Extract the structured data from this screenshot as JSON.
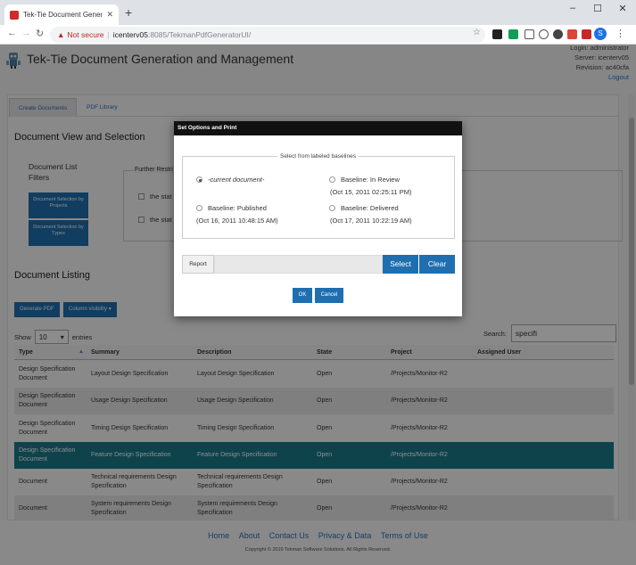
{
  "browser": {
    "tab_title": "Tek-Tie Document Generation a",
    "url_not_secure": "Not secure",
    "url_host": "icenterv05",
    "url_path": ":8085/TekmanPdfGeneratorUI/",
    "profile_initial": "S"
  },
  "header": {
    "title": "Tek-Tie Document Generation and Management",
    "login": "Login: administrator",
    "server": "Server: icenterv05",
    "revision": "Revision: ac40cfa",
    "logout": "Logout"
  },
  "tabs": [
    "Create Documents",
    "PDF Library"
  ],
  "view": {
    "title": "Document View and Selection",
    "filters_title": "Document List Filters",
    "btn_projects": "Document Selection by Projects",
    "btn_types": "Document Selection by Types",
    "further_label": "Further Restri",
    "check1": "the stat",
    "check2": "the stat"
  },
  "listing": {
    "title": "Document Listing",
    "generate_pdf": "Generate PDF",
    "column_visibility": "Column visibility",
    "show_label": "Show",
    "show_value": "10",
    "entries_label": "entries",
    "search_label": "Search:",
    "search_value": "specifi",
    "columns": [
      "Type",
      "Summary",
      "Description",
      "State",
      "Project",
      "Assigned User"
    ],
    "rows": [
      {
        "type": "Design Specification Document",
        "summary": "Layout Design Specification",
        "description": "Layout Design Specification",
        "state": "Open",
        "project": "/Projects/Monitor-R2",
        "user": ""
      },
      {
        "type": "Design Specification Document",
        "summary": "Usage Design Specification",
        "description": "Usage Design Specification",
        "state": "Open",
        "project": "/Projects/Monitor-R2",
        "user": ""
      },
      {
        "type": "Design Specification Document",
        "summary": "Timing Design Specification",
        "description": "Timing Design Specification",
        "state": "Open",
        "project": "/Projects/Monitor-R2",
        "user": ""
      },
      {
        "type": "Design Specification Document",
        "summary": "Feature Design Specification",
        "description": "Feature Design Specification",
        "state": "Open",
        "project": "/Projects/Monitor-R2",
        "user": ""
      },
      {
        "type": "Document",
        "summary": "Technical requirements Design Specification",
        "description": "Technical requirements Design Specification",
        "state": "Open",
        "project": "/Projects/Monitor-R2",
        "user": ""
      },
      {
        "type": "Document",
        "summary": "System requirements Design Specification",
        "description": "System requirements Design Specification",
        "state": "Open",
        "project": "/Projects/Monitor-R2",
        "user": ""
      }
    ]
  },
  "footer": {
    "links": [
      "Home",
      "About",
      "Contact Us",
      "Privacy & Data",
      "Terms of Use"
    ],
    "copyright": "Copyright © 2019 Tekman Software Solutions. All Rights Reserved."
  },
  "modal": {
    "title": "Set Options and Print",
    "legend": "Select from labeled baselines",
    "opt_current": "-current document-",
    "opt_review": "Baseline: In Review",
    "opt_review_date": "(Oct 15, 2011 02:25:11 PM)",
    "opt_published": "Baseline: Published",
    "opt_published_date": "(Oct 16, 2011 10:48:15 AM)",
    "opt_delivered": "Baseline: Delivered",
    "opt_delivered_date": "(Oct 17, 2011 10:22:19 AM)",
    "report_label": "Report",
    "select": "Select",
    "clear": "Clear",
    "ok": "OK",
    "cancel": "Cancel"
  },
  "colors": {
    "accent": "#1f6fb0",
    "selected_row": "#1a7a8a"
  }
}
